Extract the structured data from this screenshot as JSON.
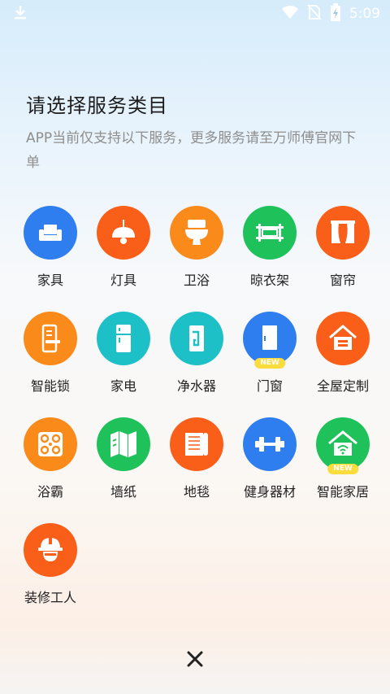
{
  "status_bar": {
    "time": "5:09"
  },
  "header": {
    "title": "请选择服务类目",
    "subtitle": "APP当前仅支持以下服务，更多服务请至万师傅官网下单"
  },
  "services": [
    {
      "label": "家具",
      "icon": "sofa-icon",
      "color": "#2f7ef0"
    },
    {
      "label": "灯具",
      "icon": "pendant-lamp-icon",
      "color": "#fa5f1a"
    },
    {
      "label": "卫浴",
      "icon": "toilet-icon",
      "color": "#fa8a1a"
    },
    {
      "label": "晾衣架",
      "icon": "clothes-rack-icon",
      "color": "#1fc25a"
    },
    {
      "label": "窗帘",
      "icon": "curtain-icon",
      "color": "#fa5f1a"
    },
    {
      "label": "智能锁",
      "icon": "smart-lock-icon",
      "color": "#fa8a1a"
    },
    {
      "label": "家电",
      "icon": "fridge-icon",
      "color": "#1ec0c8"
    },
    {
      "label": "净水器",
      "icon": "water-purifier-icon",
      "color": "#1ec0c8"
    },
    {
      "label": "门窗",
      "icon": "door-icon",
      "color": "#2f7ef0",
      "badge": "NEW"
    },
    {
      "label": "全屋定制",
      "icon": "house-icon",
      "color": "#fa5f1a"
    },
    {
      "label": "浴霸",
      "icon": "bath-heater-icon",
      "color": "#fa8a1a"
    },
    {
      "label": "墙纸",
      "icon": "wallpaper-icon",
      "color": "#1fc25a"
    },
    {
      "label": "地毯",
      "icon": "carpet-icon",
      "color": "#fa5f1a"
    },
    {
      "label": "健身器材",
      "icon": "dumbbell-icon",
      "color": "#2f7ef0"
    },
    {
      "label": "智能家居",
      "icon": "smart-home-icon",
      "color": "#1fc25a",
      "badge": "NEW"
    },
    {
      "label": "装修工人",
      "icon": "worker-icon",
      "color": "#fa5f1a"
    }
  ],
  "close": {
    "icon": "close-icon"
  }
}
